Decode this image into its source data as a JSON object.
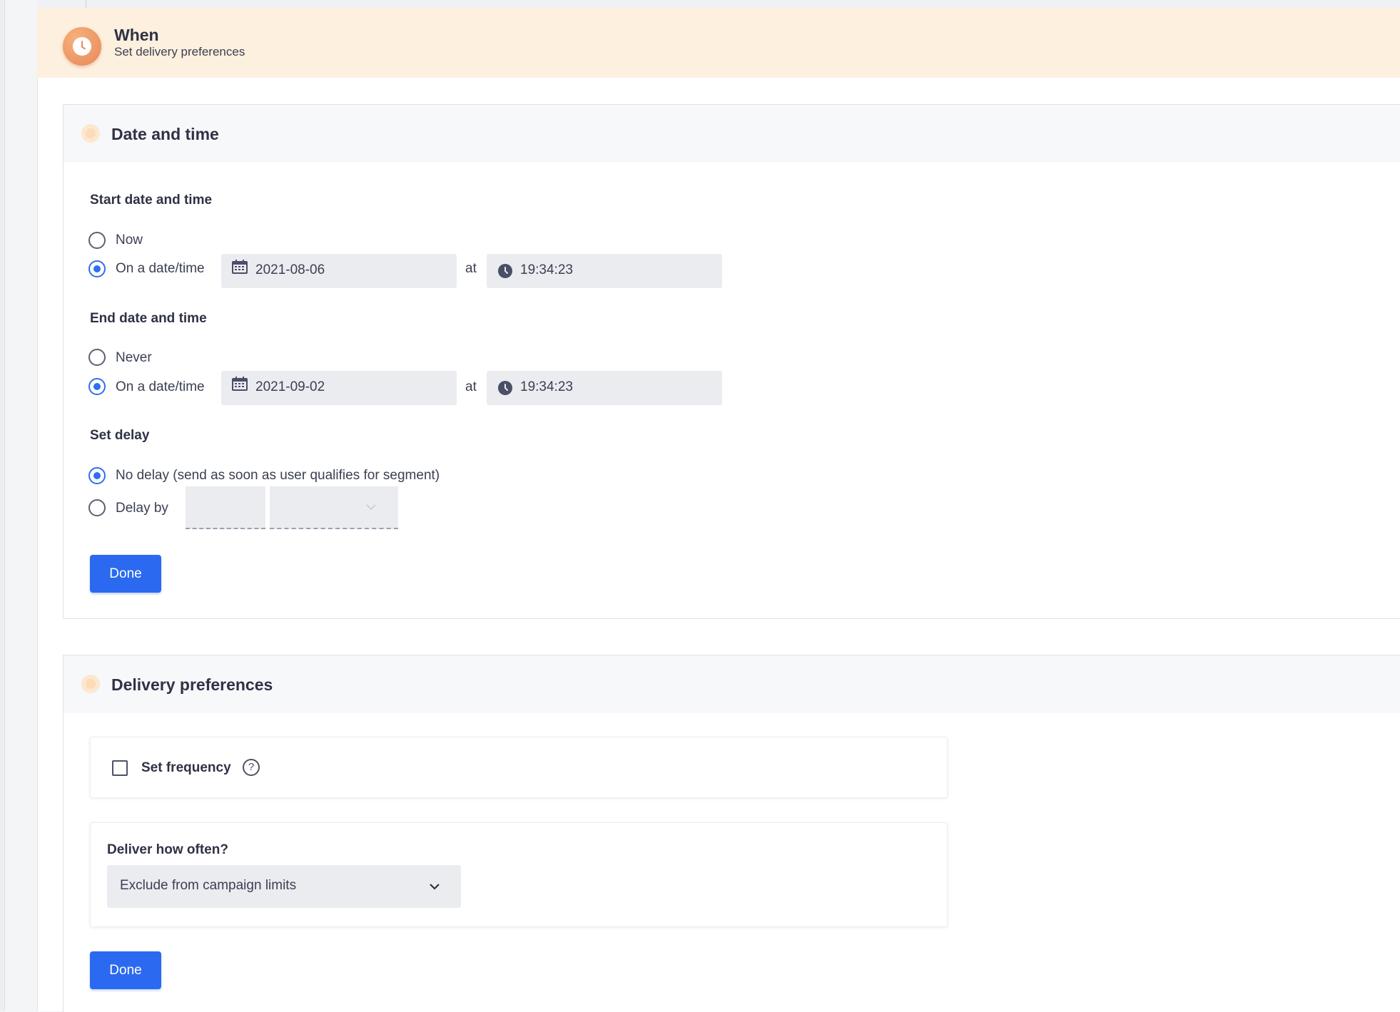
{
  "header": {
    "title": "When",
    "subtitle": "Set delivery preferences",
    "icon": "clock-icon",
    "accent": "#e9875a",
    "background": "#fdf0de"
  },
  "date_time_card": {
    "title": "Date and time",
    "start": {
      "label": "Start date and time",
      "options": [
        "Now",
        "On a date/time"
      ],
      "selected": "On a date/time",
      "date": "2021-08-06",
      "at_label": "at",
      "time": "19:34:23"
    },
    "end": {
      "label": "End date and time",
      "options": [
        "Never",
        "On a date/time"
      ],
      "selected": "On a date/time",
      "date": "2021-09-02",
      "at_label": "at",
      "time": "19:34:23"
    },
    "delay": {
      "label": "Set delay",
      "options": [
        "No delay (send as soon as user qualifies for segment)",
        "Delay by"
      ],
      "selected": "No delay (send as soon as user qualifies for segment)",
      "delay_value": "",
      "delay_unit": ""
    },
    "done_label": "Done"
  },
  "delivery_card": {
    "title": "Delivery preferences",
    "set_frequency": {
      "label": "Set frequency",
      "checked": false,
      "help_glyph": "?"
    },
    "deliver_how_often": {
      "label": "Deliver how often?",
      "selected": "Exclude from campaign limits"
    },
    "done_label": "Done"
  },
  "colors": {
    "primary": "#2b6af0",
    "radio_selected": "#2f6ef0",
    "field_bg": "#ebecf0"
  }
}
